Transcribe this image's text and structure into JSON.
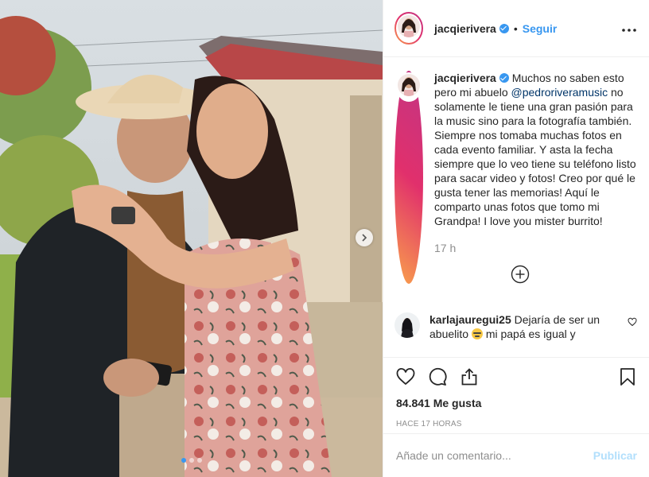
{
  "post": {
    "username": "jacqierivera",
    "follow_label": "Seguir",
    "separator": "•",
    "more_icon": "more-options-icon",
    "photo_description_icon": "photo"
  },
  "caption": {
    "username": "jacqierivera",
    "text_before": " Muchos no saben esto pero mi abuelo ",
    "mention": "@pedroriveramusic",
    "text_after": " no solamente le tiene una gran pasión para la music sino para la fotografía también. Siempre nos tomaba muchas fotos en cada evento familiar. Y asta la fecha siempre que lo veo tiene su teléfono listo para sacar video y fotos! Creo por qué le gusta tener las memorias! Aquí le comparto unas fotos que tomo mi Grandpa! I love you mister burrito!",
    "time": "17 h"
  },
  "comments": [
    {
      "username": "karlajauregui25",
      "text_before": " Dejaría de ser un abuelito ",
      "text_after": " mi papá es igual y"
    }
  ],
  "stats": {
    "likes": "84.841 Me gusta",
    "posted_ago": "HACE 17 HORAS"
  },
  "compose": {
    "placeholder": "Añade un comentario...",
    "publish_label": "Publicar"
  },
  "carousel": {
    "count": 3,
    "active_index": 0
  },
  "colors": {
    "accent": "#3897f0",
    "publish_disabled": "#b2dffc",
    "muted": "#8e8e8e"
  }
}
